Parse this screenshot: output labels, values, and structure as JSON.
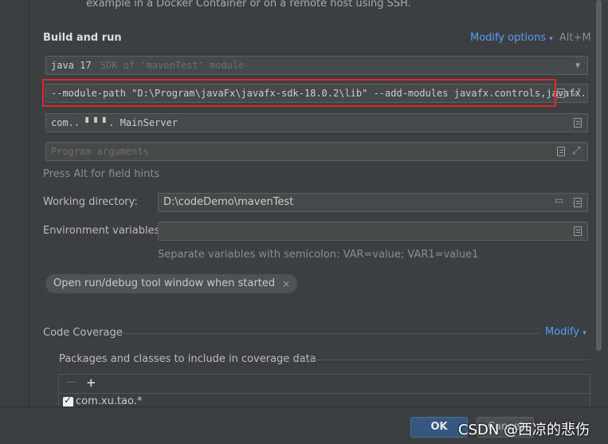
{
  "top_note": "example in a Docker Container or on a remote host using SSH.",
  "build_run": {
    "title": "Build and run",
    "modify_options": "Modify options",
    "modify_shortcut": "Alt+M",
    "sdk_value": "java 17",
    "sdk_suffix": "SDK of 'mavenTest' module",
    "vm_options": "--module-path \"D:\\Program\\javaFx\\javafx-sdk-18.0.2\\lib\" --add-modules javafx.controls,javafx.fxml",
    "main_class": "com.. ▘▝ ▘. MainServer",
    "program_args_placeholder": "Program arguments",
    "field_hint": "Press Alt for field hints"
  },
  "working_dir": {
    "label": "Working directory:",
    "value": "D:\\codeDemo\\mavenTest"
  },
  "env_vars": {
    "label": "Environment variables:",
    "value": "",
    "hint": "Separate variables with semicolon: VAR=value; VAR1=value1"
  },
  "chip": {
    "label": "Open run/debug tool window when started",
    "close": "×"
  },
  "coverage": {
    "title": "Code Coverage",
    "modify": "Modify",
    "packages_label": "Packages and classes to include in coverage data",
    "remove_glyph": "—",
    "add_glyph": "+",
    "rows": [
      {
        "checked": true,
        "label": "com.xu.tao.*"
      }
    ]
  },
  "footer": {
    "ok": "OK",
    "cancel": "Cancel"
  },
  "watermark": "CSDN @西凉的悲伤",
  "colors": {
    "accent": "#589df6",
    "highlight_border": "#e5262c",
    "ok_button": "#365880"
  }
}
